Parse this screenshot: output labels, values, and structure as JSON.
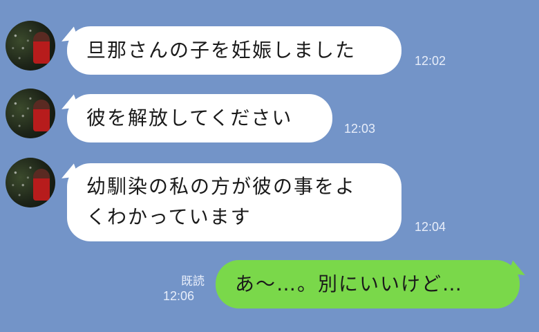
{
  "messages": [
    {
      "text": "旦那さんの子を妊娠しました",
      "time": "12:02"
    },
    {
      "text": "彼を解放してください",
      "time": "12:03"
    },
    {
      "line1": "幼馴染の私の方が彼の事をよ",
      "line2": "くわかっています",
      "time": "12:04"
    }
  ],
  "sent": {
    "text": "あ〜…。別にいいけど…",
    "read_label": "既読",
    "time": "12:06"
  },
  "colors": {
    "background": "#7394c8",
    "received_bubble": "#ffffff",
    "sent_bubble": "#7ad84a"
  }
}
